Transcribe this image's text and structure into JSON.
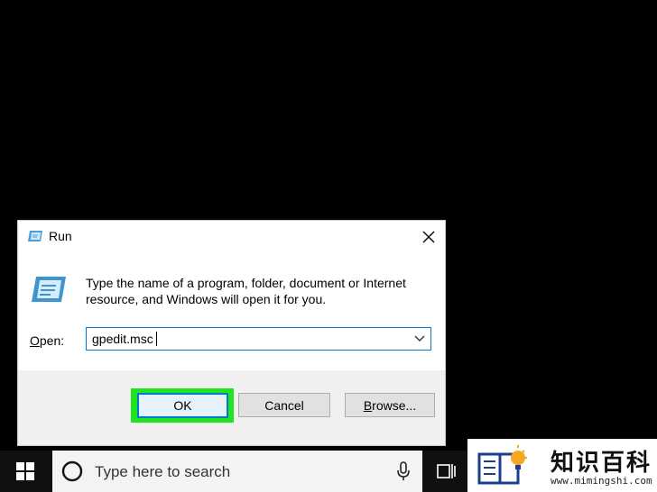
{
  "dialog": {
    "title": "Run",
    "description": "Type the name of a program, folder, document or Internet resource, and Windows will open it for you.",
    "open_label_accel": "O",
    "open_label_rest": "pen:",
    "input_value": "gpedit.msc",
    "buttons": {
      "ok": "OK",
      "cancel": "Cancel",
      "browse_accel": "B",
      "browse_rest": "rowse..."
    },
    "highlight_color": "#1fe51f"
  },
  "taskbar": {
    "search_placeholder": "Type here to search"
  },
  "watermark": {
    "title": "知识百科",
    "url": "www.mimingshi.com"
  }
}
